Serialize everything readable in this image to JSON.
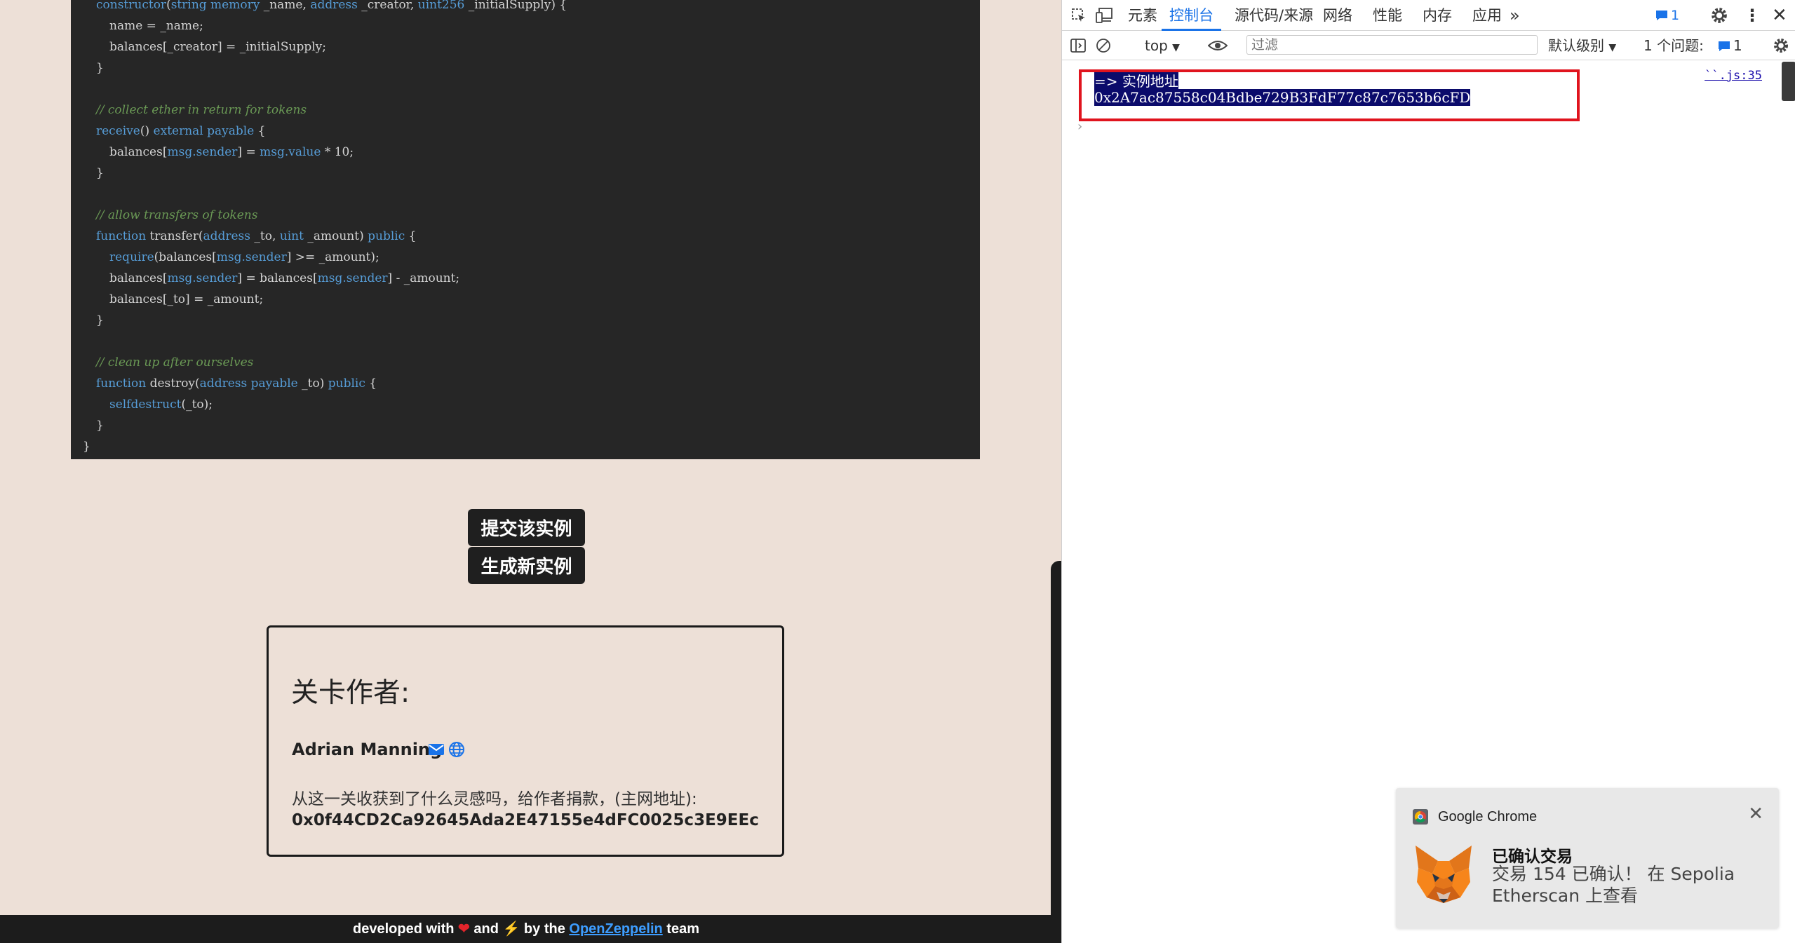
{
  "code": {
    "lines": [
      {
        "segments": [
          {
            "t": "constructor",
            "c": "kw"
          },
          {
            "t": "(",
            "c": ""
          },
          {
            "t": "string memory",
            "c": "kw"
          },
          {
            "t": " _name, ",
            "c": ""
          },
          {
            "t": "address",
            "c": "kw"
          },
          {
            "t": " _creator, ",
            "c": ""
          },
          {
            "t": "uint256",
            "c": "kw"
          },
          {
            "t": " _initialSupply) {",
            "c": ""
          }
        ],
        "indent": 1
      },
      {
        "segments": [
          {
            "t": "name = _name;",
            "c": ""
          }
        ],
        "indent": 2
      },
      {
        "segments": [
          {
            "t": "balances[_creator] = _initialSupply;",
            "c": ""
          }
        ],
        "indent": 2
      },
      {
        "segments": [
          {
            "t": "}",
            "c": ""
          }
        ],
        "indent": 1
      },
      {
        "segments": [],
        "indent": 0
      },
      {
        "segments": [
          {
            "t": "// collect ether in return for tokens",
            "c": "cm"
          }
        ],
        "indent": 1
      },
      {
        "segments": [
          {
            "t": "receive",
            "c": "kw"
          },
          {
            "t": "() ",
            "c": ""
          },
          {
            "t": "external payable",
            "c": "kw"
          },
          {
            "t": " {",
            "c": ""
          }
        ],
        "indent": 1
      },
      {
        "segments": [
          {
            "t": "balances[",
            "c": ""
          },
          {
            "t": "msg.sender",
            "c": "kw"
          },
          {
            "t": "] = ",
            "c": ""
          },
          {
            "t": "msg.value",
            "c": "kw"
          },
          {
            "t": " * 10;",
            "c": ""
          }
        ],
        "indent": 2
      },
      {
        "segments": [
          {
            "t": "}",
            "c": ""
          }
        ],
        "indent": 1
      },
      {
        "segments": [],
        "indent": 0
      },
      {
        "segments": [
          {
            "t": "// allow transfers of tokens",
            "c": "cm"
          }
        ],
        "indent": 1
      },
      {
        "segments": [
          {
            "t": "function",
            "c": "kw"
          },
          {
            "t": " transfer(",
            "c": ""
          },
          {
            "t": "address",
            "c": "kw"
          },
          {
            "t": " _to, ",
            "c": ""
          },
          {
            "t": "uint",
            "c": "kw"
          },
          {
            "t": " _amount) ",
            "c": ""
          },
          {
            "t": "public",
            "c": "kw"
          },
          {
            "t": " {",
            "c": ""
          }
        ],
        "indent": 1
      },
      {
        "segments": [
          {
            "t": "require",
            "c": "kw"
          },
          {
            "t": "(balances[",
            "c": ""
          },
          {
            "t": "msg.sender",
            "c": "kw"
          },
          {
            "t": "] >= _amount);",
            "c": ""
          }
        ],
        "indent": 2
      },
      {
        "segments": [
          {
            "t": "balances[",
            "c": ""
          },
          {
            "t": "msg.sender",
            "c": "kw"
          },
          {
            "t": "] = balances[",
            "c": ""
          },
          {
            "t": "msg.sender",
            "c": "kw"
          },
          {
            "t": "] - _amount;",
            "c": ""
          }
        ],
        "indent": 2
      },
      {
        "segments": [
          {
            "t": "balances[_to] = _amount;",
            "c": ""
          }
        ],
        "indent": 2
      },
      {
        "segments": [
          {
            "t": "}",
            "c": ""
          }
        ],
        "indent": 1
      },
      {
        "segments": [],
        "indent": 0
      },
      {
        "segments": [
          {
            "t": "// clean up after ourselves",
            "c": "cm"
          }
        ],
        "indent": 1
      },
      {
        "segments": [
          {
            "t": "function",
            "c": "kw"
          },
          {
            "t": " destroy(",
            "c": ""
          },
          {
            "t": "address payable",
            "c": "kw"
          },
          {
            "t": " _to) ",
            "c": ""
          },
          {
            "t": "public",
            "c": "kw"
          },
          {
            "t": " {",
            "c": ""
          }
        ],
        "indent": 1
      },
      {
        "segments": [
          {
            "t": "selfdestruct",
            "c": "kw"
          },
          {
            "t": "(_to);",
            "c": ""
          }
        ],
        "indent": 2
      },
      {
        "segments": [
          {
            "t": "}",
            "c": ""
          }
        ],
        "indent": 1
      },
      {
        "segments": [
          {
            "t": "}",
            "c": ""
          }
        ],
        "indent": 0
      }
    ]
  },
  "buttons": {
    "submit": "提交该实例",
    "new_instance": "生成新实例"
  },
  "author": {
    "heading": "关卡作者:",
    "name": "Adrian Manning",
    "icons": [
      "envelope-icon",
      "globe-icon"
    ],
    "donate_text": "从这一关收获到了什么灵感吗，给作者捐款，(主网地址):",
    "donate_address": "0x0f44CD2Ca92645Ada2E47155e4dFC0025c3E9EEc"
  },
  "footer": {
    "pre": "developed with ",
    "and": " and ",
    "by": " by the ",
    "link": "OpenZeppelin",
    "post": " team"
  },
  "devtools": {
    "tabs": [
      "元素",
      "控制台",
      "源代码/来源",
      "网络",
      "性能",
      "内存",
      "应用"
    ],
    "active_tab": "控制台",
    "issues_badge": "1",
    "context": "top",
    "filter_placeholder": "过滤",
    "level": "默认级别",
    "issues_label": "1 个问题:",
    "issues_count": "1",
    "console_lines": [
      "=> 实例地址",
      "0x2A7ac87558c04Bdbe729B3FdF77c87c7653b6cFD"
    ],
    "source_link": "``.js:35"
  },
  "notification": {
    "app": "Google Chrome",
    "title": "已确认交易",
    "body": "交易 154 已确认！ 在 Sepolia Etherscan 上查看"
  },
  "colors": {
    "accent": "#1a73e8",
    "highlight_border": "#e0141e",
    "page_bg": "#ede0d7",
    "code_bg": "#262626"
  }
}
